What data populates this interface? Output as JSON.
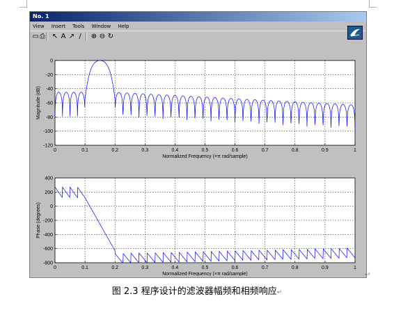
{
  "window": {
    "title": "No. 1",
    "menu": [
      "View",
      "Insert",
      "Tools",
      "Window",
      "Help"
    ],
    "toolbar_icons": [
      "save-icon",
      "print-icon",
      "pointer-icon",
      "text-icon",
      "arrow-icon",
      "line-icon",
      "zoom-in-icon",
      "zoom-out-icon",
      "rotate-icon"
    ],
    "toolbar_glyphs": [
      "▭",
      "⎙",
      "↖",
      "A",
      "↗",
      "/",
      "⊕",
      "⊖",
      "↻"
    ]
  },
  "chart_data": [
    {
      "type": "line",
      "title": "",
      "xlabel": "Normalized Frequency  (×π rad/sample)",
      "ylabel": "Magnitude (dB)",
      "xlim": [
        0,
        1
      ],
      "ylim": [
        -120,
        0
      ],
      "xticks": [
        "0",
        "0.1",
        "0.2",
        "0.3",
        "0.4",
        "0.5",
        "0.6",
        "0.7",
        "0.8",
        "0.9",
        "1"
      ],
      "yticks": [
        "0",
        "-20",
        "-40",
        "-60",
        "-80",
        "-100",
        "-120"
      ],
      "grid": true,
      "passband": [
        0.1,
        0.2
      ],
      "peak_db": 0,
      "stopband_sidelobe_db": [
        -45,
        -70
      ],
      "lobe_count_lower": 4,
      "lobe_count_upper": 30
    },
    {
      "type": "line",
      "title": "",
      "xlabel": "Normalized Frequency  (×π rad/sample)",
      "ylabel": "Phase (degrees)",
      "xlim": [
        0,
        1
      ],
      "ylim": [
        -800,
        400
      ],
      "xticks": [
        "0",
        "0.1",
        "0.2",
        "0.3",
        "0.4",
        "0.5",
        "0.6",
        "0.7",
        "0.8",
        "0.9",
        "1"
      ],
      "yticks": [
        "400",
        "200",
        "0",
        "-200",
        "-400",
        "-600",
        "-800"
      ],
      "grid": true,
      "phase_start_range": [
        120,
        270
      ],
      "phase_passband_end": -630,
      "phase_stopband_range": [
        -760,
        -560
      ]
    }
  ],
  "caption": {
    "text": "图 2.3  程序设计的滤波器幅频和相频响应",
    "mark": "↵"
  },
  "enter_mark": "↵",
  "colors": {
    "line": "#0000ff",
    "axes_bg": "#ffffff",
    "figure_bg": "#c0c0c0"
  }
}
